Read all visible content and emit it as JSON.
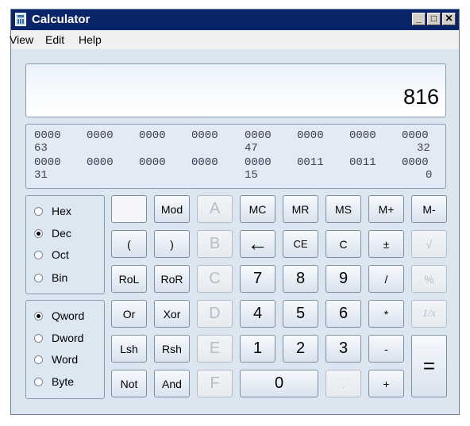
{
  "window": {
    "title": "Calculator",
    "minimize": "_",
    "maximize": "□",
    "close": "✕"
  },
  "menu": [
    "View",
    "Edit",
    "Help"
  ],
  "display": {
    "value": "816"
  },
  "bits": {
    "row1": [
      "0000",
      "0000",
      "0000",
      "0000",
      "0000",
      "0000",
      "0000",
      "0000"
    ],
    "row1_marks": [
      "63",
      "47",
      "32"
    ],
    "row2": [
      "0000",
      "0000",
      "0000",
      "0000",
      "0000",
      "0011",
      "0011",
      "0000"
    ],
    "row2_marks": [
      "31",
      "15",
      "0"
    ]
  },
  "base": [
    {
      "label": "Hex",
      "checked": false
    },
    {
      "label": "Dec",
      "checked": true
    },
    {
      "label": "Oct",
      "checked": false
    },
    {
      "label": "Bin",
      "checked": false
    }
  ],
  "size": [
    {
      "label": "Qword",
      "checked": true
    },
    {
      "label": "Dword",
      "checked": false
    },
    {
      "label": "Word",
      "checked": false
    },
    {
      "label": "Byte",
      "checked": false
    }
  ],
  "buttons": {
    "mod": "Mod",
    "a": "A",
    "mc": "MC",
    "mr": "MR",
    "ms": "MS",
    "mplus": "M+",
    "mminus": "M-",
    "lparen": "(",
    "rparen": ")",
    "b": "B",
    "back": "←",
    "ce": "CE",
    "c": "C",
    "plusminus": "±",
    "sqrt": "√",
    "rol": "RoL",
    "ror": "RoR",
    "cc": "C",
    "n7": "7",
    "n8": "8",
    "n9": "9",
    "div": "/",
    "pct": "%",
    "or": "Or",
    "xor": "Xor",
    "d": "D",
    "n4": "4",
    "n5": "5",
    "n6": "6",
    "mul": "*",
    "recip": "1/x",
    "lsh": "Lsh",
    "rsh": "Rsh",
    "e": "E",
    "n1": "1",
    "n2": "2",
    "n3": "3",
    "sub": "-",
    "eq": "=",
    "not": "Not",
    "and": "And",
    "f": "F",
    "n0": "0",
    "dot": ".",
    "add": "+"
  }
}
